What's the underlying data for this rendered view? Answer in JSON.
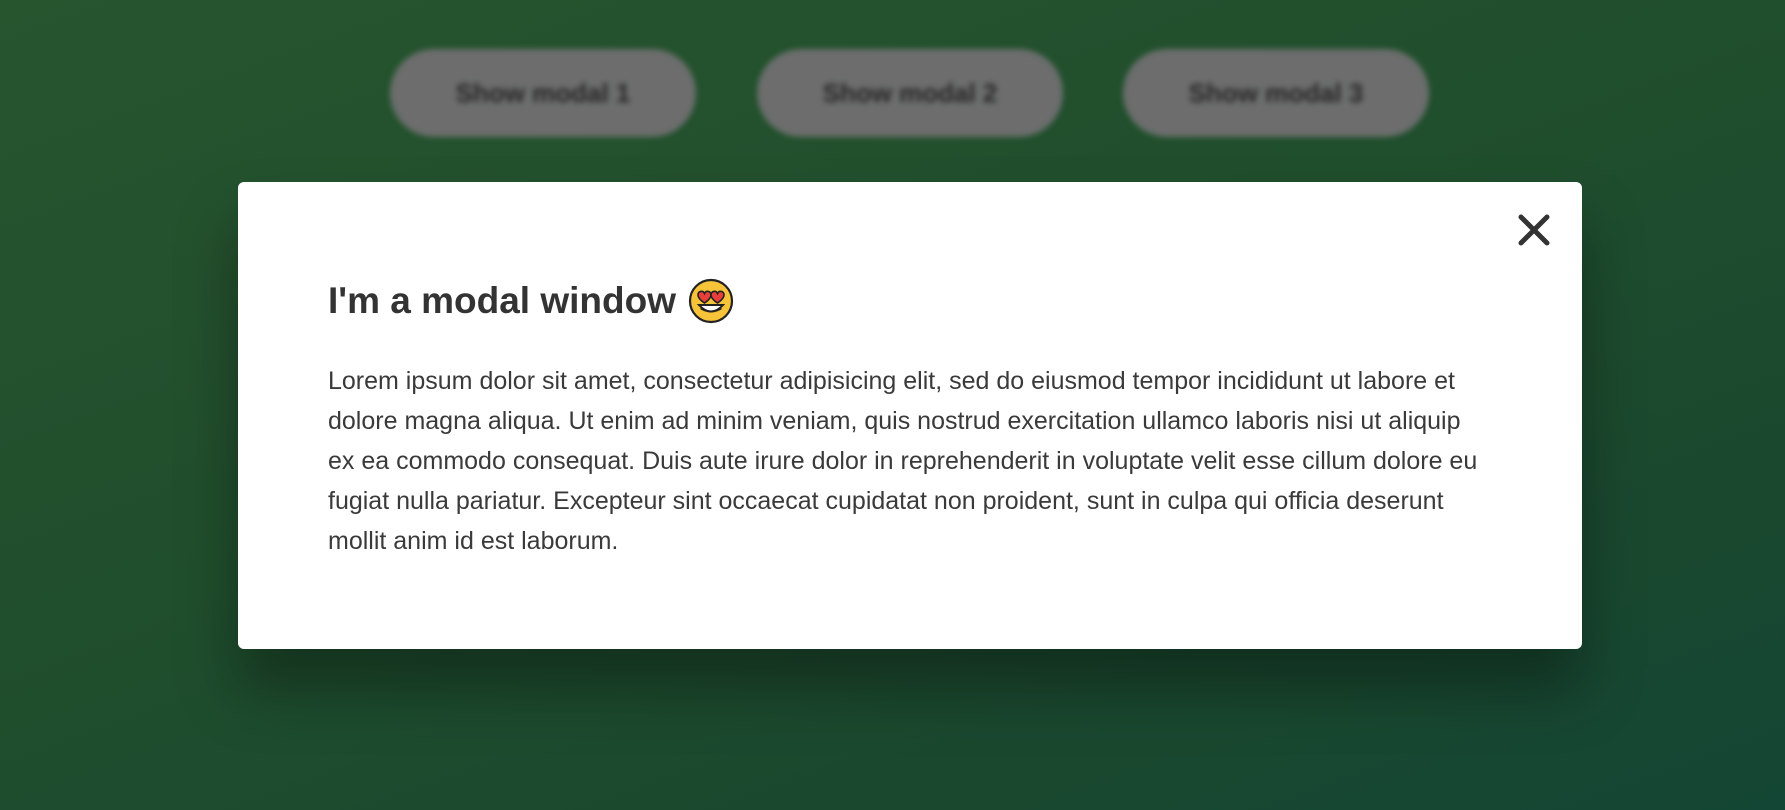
{
  "background_buttons": [
    {
      "label": "Show modal 1"
    },
    {
      "label": "Show modal 2"
    },
    {
      "label": "Show modal 3"
    }
  ],
  "modal": {
    "title": "I'm a modal window",
    "title_icon": "heart-eyes-emoji",
    "body": "Lorem ipsum dolor sit amet, consectetur adipisicing elit, sed do eiusmod tempor incididunt ut labore et dolore magna aliqua. Ut enim ad minim veniam, quis nostrud exercitation ullamco laboris nisi ut aliquip ex ea commodo consequat. Duis aute irure dolor in reprehenderit in voluptate velit esse cillum dolore eu fugiat nulla pariatur. Excepteur sint occaecat cupidatat non proident, sunt in culpa qui officia deserunt mollit anim id est laborum.",
    "close_icon": "close-icon"
  },
  "colors": {
    "background": "#255a34",
    "modal_bg": "#ffffff",
    "text": "#333333",
    "button_bg": "#7b7d7c"
  }
}
